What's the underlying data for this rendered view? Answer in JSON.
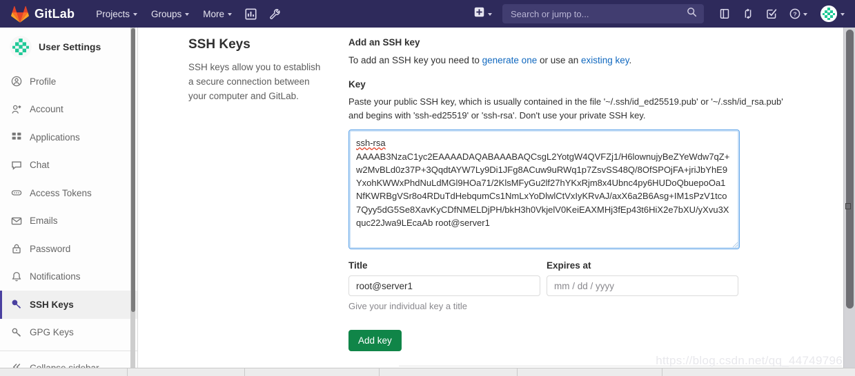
{
  "navbar": {
    "brand": "GitLab",
    "links": [
      {
        "label": "Projects",
        "icon": "chevron-down-icon"
      },
      {
        "label": "Groups",
        "icon": "chevron-down-icon"
      },
      {
        "label": "More",
        "icon": "chevron-down-icon"
      }
    ],
    "icon_buttons": [
      {
        "name": "analytics-icon",
        "label": ""
      },
      {
        "name": "wrench-icon",
        "label": ""
      }
    ],
    "new_button": {
      "name": "plus-square-icon",
      "label": ""
    },
    "search": {
      "placeholder": "Search or jump to...",
      "value": "",
      "icon": "search-icon"
    },
    "right_icons": [
      {
        "name": "issues-icon"
      },
      {
        "name": "merge-requests-icon"
      },
      {
        "name": "todos-icon"
      },
      {
        "name": "help-icon"
      }
    ],
    "avatar": {
      "name": "user-avatar"
    },
    "colors": {
      "background": "#2e2a5b",
      "search_bg": "#413d70"
    }
  },
  "sidebar": {
    "title": "User Settings",
    "items": [
      {
        "label": "Profile",
        "icon": "profile-icon",
        "active": false
      },
      {
        "label": "Account",
        "icon": "account-icon",
        "active": false
      },
      {
        "label": "Applications",
        "icon": "applications-icon",
        "active": false
      },
      {
        "label": "Chat",
        "icon": "chat-icon",
        "active": false
      },
      {
        "label": "Access Tokens",
        "icon": "access-tokens-icon",
        "active": false
      },
      {
        "label": "Emails",
        "icon": "email-icon",
        "active": false
      },
      {
        "label": "Password",
        "icon": "lock-icon",
        "active": false
      },
      {
        "label": "Notifications",
        "icon": "bell-icon",
        "active": false
      },
      {
        "label": "SSH Keys",
        "icon": "key-icon",
        "active": true
      },
      {
        "label": "GPG Keys",
        "icon": "key-icon",
        "active": false
      }
    ],
    "collapse": {
      "label": "Collapse sidebar",
      "icon": "double-chevron-left-icon"
    },
    "active_color": "#4a40a0"
  },
  "main": {
    "page_title": "SSH Keys",
    "page_description": "SSH keys allow you to establish a secure connection between your computer and GitLab.",
    "section_heading": "Add an SSH key",
    "intro_prefix": "To add an SSH key you need to ",
    "intro_link_1": "generate one",
    "intro_middle": " or use an ",
    "intro_link_2": "existing key",
    "intro_suffix": ".",
    "key_label": "Key",
    "key_help": "Paste your public SSH key, which is usually contained in the file '~/.ssh/id_ed25519.pub' or '~/.ssh/id_rsa.pub' and begins with 'ssh-ed25519' or 'ssh-rsa'. Don't use your private SSH key.",
    "key_value_prefix": "ssh-rsa",
    "key_value_body": "\nAAAAB3NzaC1yc2EAAAADAQABAAABAQCsgL2YotgW4QVFZj1/H6lownujyBeZYeWdw7qZ+w2MvBLd0z37P+3QqdtAYW7Ly9Di1JFg8ACuw9uRWq1p7ZsvSS48Q/8OfSPOjFA+jriJbYhE9YxohKWWxPhdNuLdMGl9HOa71/2KlsMFyGu2lf27hYKxRjm8x4Ubnc4py6HUDoQbuepoOa1NfKWRBgVSr8o4RDuTdHebqumCs1NmLxYoDlwlCtVxIyKRvAJ/axX6a2B6Asg+IM1sPzV1tco7Qyy5dG5Se8XavKyCDfNMELDjPH/bkH3h0VkjelV0KeiEAXMHj3fEp43t6HiX2e7bXU/yXvu3Xquc22Jwa9LEcaAb root@server1\n",
    "title_label": "Title",
    "title_value": "root@server1",
    "title_help": "Give your individual key a title",
    "expires_label": "Expires at",
    "expires_placeholder": "mm / dd / yyyy",
    "expires_value": "",
    "submit_label": "Add key",
    "submit_color": "#108548"
  },
  "watermark": {
    "text": "https://blog.csdn.net/qq_44749796"
  },
  "scrollbars": {
    "sidebar": {
      "name": "sidebar-scrollbar"
    },
    "page": {
      "name": "page-scrollbar"
    }
  }
}
